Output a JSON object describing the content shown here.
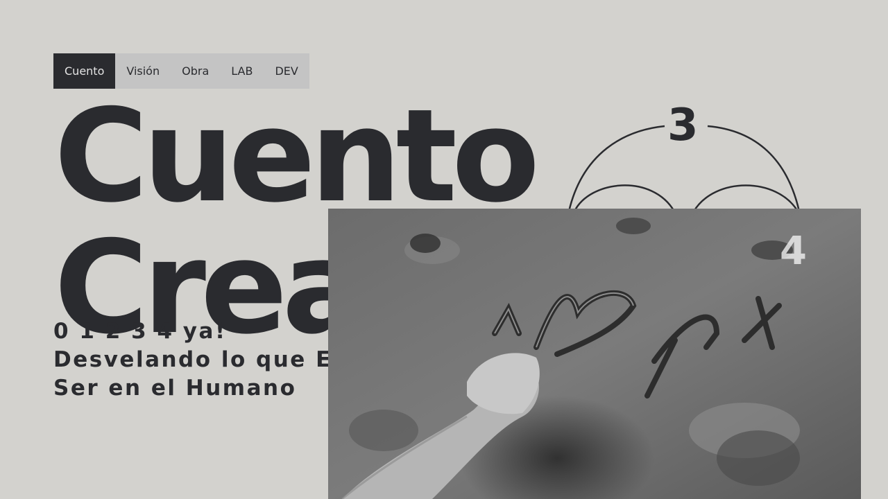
{
  "nav": {
    "items": [
      {
        "label": "Cuento",
        "active": true
      },
      {
        "label": "Visión",
        "active": false
      },
      {
        "label": "Obra",
        "active": false
      },
      {
        "label": "LAB",
        "active": false
      },
      {
        "label": "DEV",
        "active": false
      }
    ]
  },
  "hero": {
    "title_line1": "Cuento",
    "title_line2": "Creación"
  },
  "subtitle": {
    "line1": "0 1 2 3 4 ya!",
    "line2": "Desvelando lo que Es",
    "line3": "Ser en el Humano"
  },
  "diagram": {
    "labels": [
      "3",
      "4"
    ]
  },
  "colors": {
    "background": "#d3d2ce",
    "text": "#2a2b2f",
    "nav_background": "#c4c4c4",
    "nav_active_background": "#2a2b2f"
  }
}
